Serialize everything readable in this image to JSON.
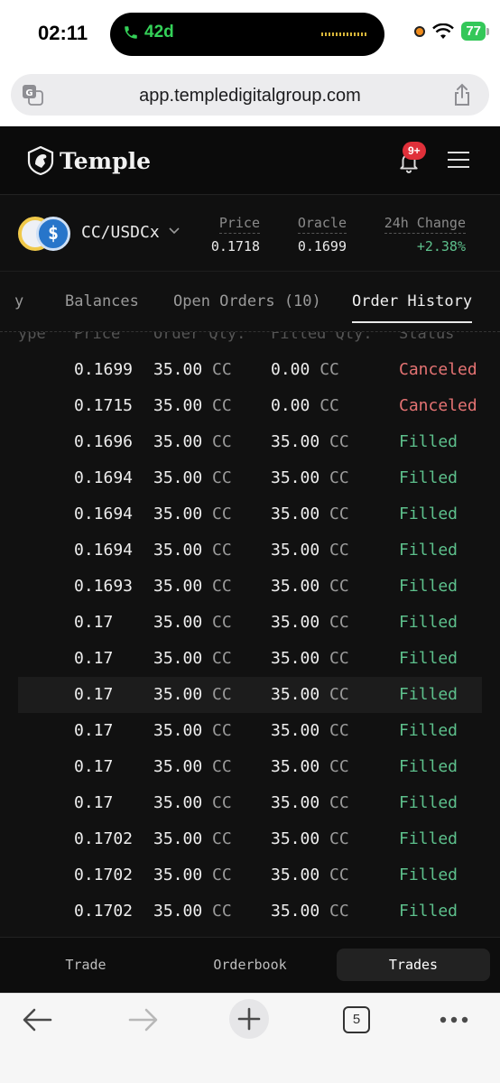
{
  "status_bar": {
    "time": "02:11",
    "call_label": "42d",
    "battery": "77"
  },
  "browser": {
    "url": "app.templedigitalgroup.com",
    "open_tabs_count": "5"
  },
  "app": {
    "brand": "Temple",
    "notification_badge": "9+",
    "market": {
      "pair": "CC/USDCx",
      "price_label": "Price",
      "price_value": "0.1718",
      "oracle_label": "Oracle",
      "oracle_value": "0.1699",
      "change_label": "24h Change",
      "change_value": "+2.38%"
    },
    "tabs": [
      {
        "label": "y"
      },
      {
        "label": "Balances"
      },
      {
        "label": "Open Orders (10)"
      },
      {
        "label": "Order History"
      }
    ],
    "table": {
      "header_partial": {
        "type": "ype",
        "price": "Price",
        "order_qty": "Order Qty.",
        "filled_qty": "Filled Qty.",
        "status": "Status"
      },
      "rows": [
        {
          "price": "0.1699",
          "qty": "35.00",
          "qty_unit": "CC",
          "filled": "0.00",
          "filled_unit": "CC",
          "status": "Canceled"
        },
        {
          "price": "0.1715",
          "qty": "35.00",
          "qty_unit": "CC",
          "filled": "0.00",
          "filled_unit": "CC",
          "status": "Canceled"
        },
        {
          "price": "0.1696",
          "qty": "35.00",
          "qty_unit": "CC",
          "filled": "35.00",
          "filled_unit": "CC",
          "status": "Filled"
        },
        {
          "price": "0.1694",
          "qty": "35.00",
          "qty_unit": "CC",
          "filled": "35.00",
          "filled_unit": "CC",
          "status": "Filled"
        },
        {
          "price": "0.1694",
          "qty": "35.00",
          "qty_unit": "CC",
          "filled": "35.00",
          "filled_unit": "CC",
          "status": "Filled"
        },
        {
          "price": "0.1694",
          "qty": "35.00",
          "qty_unit": "CC",
          "filled": "35.00",
          "filled_unit": "CC",
          "status": "Filled"
        },
        {
          "price": "0.1693",
          "qty": "35.00",
          "qty_unit": "CC",
          "filled": "35.00",
          "filled_unit": "CC",
          "status": "Filled"
        },
        {
          "price": "0.17",
          "qty": "35.00",
          "qty_unit": "CC",
          "filled": "35.00",
          "filled_unit": "CC",
          "status": "Filled"
        },
        {
          "price": "0.17",
          "qty": "35.00",
          "qty_unit": "CC",
          "filled": "35.00",
          "filled_unit": "CC",
          "status": "Filled"
        },
        {
          "price": "0.17",
          "qty": "35.00",
          "qty_unit": "CC",
          "filled": "35.00",
          "filled_unit": "CC",
          "status": "Filled"
        },
        {
          "price": "0.17",
          "qty": "35.00",
          "qty_unit": "CC",
          "filled": "35.00",
          "filled_unit": "CC",
          "status": "Filled"
        },
        {
          "price": "0.17",
          "qty": "35.00",
          "qty_unit": "CC",
          "filled": "35.00",
          "filled_unit": "CC",
          "status": "Filled"
        },
        {
          "price": "0.17",
          "qty": "35.00",
          "qty_unit": "CC",
          "filled": "35.00",
          "filled_unit": "CC",
          "status": "Filled"
        },
        {
          "price": "0.1702",
          "qty": "35.00",
          "qty_unit": "CC",
          "filled": "35.00",
          "filled_unit": "CC",
          "status": "Filled"
        },
        {
          "price": "0.1702",
          "qty": "35.00",
          "qty_unit": "CC",
          "filled": "35.00",
          "filled_unit": "CC",
          "status": "Filled"
        },
        {
          "price": "0.1702",
          "qty": "35.00",
          "qty_unit": "CC",
          "filled": "35.00",
          "filled_unit": "CC",
          "status": "Filled"
        }
      ]
    },
    "bottom_tabs": [
      {
        "label": "Trade"
      },
      {
        "label": "Orderbook"
      },
      {
        "label": "Trades"
      }
    ]
  },
  "colors": {
    "positive": "#5dc08c",
    "negative": "#e57373",
    "background": "#111111",
    "badge": "#e0303a"
  },
  "icons": [
    "phone-icon",
    "wifi-icon",
    "translate-icon",
    "share-icon",
    "temple-logo-icon",
    "bell-icon",
    "menu-icon",
    "chevron-down-icon",
    "back-arrow-icon",
    "forward-arrow-icon",
    "plus-icon",
    "tabs-icon",
    "more-icon"
  ]
}
